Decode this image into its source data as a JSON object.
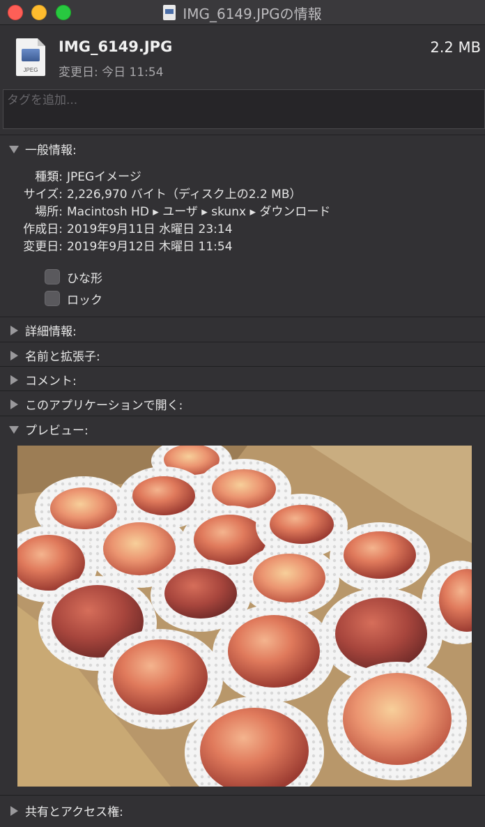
{
  "window": {
    "title": "IMG_6149.JPGの情報"
  },
  "header": {
    "file_name": "IMG_6149.JPG",
    "file_size": "2.2 MB",
    "modified": "変更日: 今日 11:54",
    "icon_label": "JPEG"
  },
  "tags": {
    "placeholder": "タグを追加..."
  },
  "general": {
    "title": "一般情報:",
    "rows": [
      {
        "key": "種類:",
        "value": "JPEGイメージ"
      },
      {
        "key": "サイズ:",
        "value": "2,226,970 バイト（ディスク上の2.2 MB）"
      },
      {
        "key": "場所:",
        "value": "Macintosh HD ▸ ユーザ ▸ skunx ▸ ダウンロード"
      },
      {
        "key": "作成日:",
        "value": "2019年9月11日 水曜日 23:14"
      },
      {
        "key": "変更日:",
        "value": "2019年9月12日 木曜日 11:54"
      }
    ],
    "checkboxes": [
      {
        "label": "ひな形",
        "checked": false
      },
      {
        "label": "ロック",
        "checked": false
      }
    ]
  },
  "sections": {
    "more_info": "詳細情報:",
    "name_ext": "名前と拡張子:",
    "comments": "コメント:",
    "open_with": "このアプリケーションで開く:",
    "preview": "プレビュー:",
    "sharing": "共有とアクセス権:"
  },
  "colors": {
    "window_bg": "#323134",
    "close": "#fe5f57",
    "minimize": "#febc2e",
    "zoom": "#28c840"
  }
}
